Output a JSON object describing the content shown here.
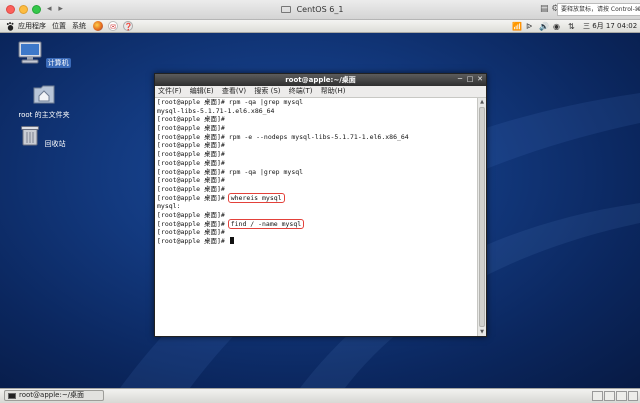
{
  "mac": {
    "window_title": "CentOS 6_1",
    "notice": "要释放鼠标，请按 Control-⌘",
    "controls": "◂ ▸"
  },
  "gnome_panel": {
    "menus": [
      "应用程序",
      "位置",
      "系统"
    ],
    "clock": "三 6月 17 04:02"
  },
  "desktop": {
    "icons": [
      {
        "label": "计算机",
        "selected": true
      },
      {
        "label": "root 的主文件夹",
        "selected": false
      },
      {
        "label": "回收站",
        "selected": false
      }
    ]
  },
  "terminal": {
    "title": "root@apple:~/桌面",
    "menu": [
      "文件(F)",
      "编辑(E)",
      "查看(V)",
      "搜索 (S)",
      "终端(T)",
      "帮助(H)"
    ],
    "prompt": "[root@apple 桌面]# ",
    "lines": [
      {
        "prompt": true,
        "text": "rpm -qa |grep mysql",
        "highlight": false
      },
      {
        "prompt": false,
        "text": "mysql-libs-5.1.71-1.el6.x86_64",
        "highlight": false
      },
      {
        "prompt": true,
        "text": "",
        "highlight": false
      },
      {
        "prompt": true,
        "text": "",
        "highlight": false
      },
      {
        "prompt": true,
        "text": "rpm -e --nodeps mysql-libs-5.1.71-1.el6.x86_64",
        "highlight": false
      },
      {
        "prompt": true,
        "text": "",
        "highlight": false
      },
      {
        "prompt": true,
        "text": "",
        "highlight": false
      },
      {
        "prompt": true,
        "text": "",
        "highlight": false
      },
      {
        "prompt": true,
        "text": "rpm -qa |grep mysql",
        "highlight": false
      },
      {
        "prompt": true,
        "text": "",
        "highlight": false
      },
      {
        "prompt": true,
        "text": "",
        "highlight": false
      },
      {
        "prompt": true,
        "text": "whereis mysql",
        "highlight": true
      },
      {
        "prompt": false,
        "text": "mysql:",
        "highlight": false
      },
      {
        "prompt": true,
        "text": "",
        "highlight": false
      },
      {
        "prompt": true,
        "text": "find / -name mysql",
        "highlight": true
      },
      {
        "prompt": true,
        "text": "",
        "highlight": false
      },
      {
        "prompt": true,
        "text": "",
        "highlight": false,
        "cursor": true
      }
    ]
  },
  "taskbar": {
    "task_label": "root@apple:~/桌面"
  },
  "colors": {
    "highlight_box": "#e3413a",
    "desktop_bg": "#133a80"
  }
}
